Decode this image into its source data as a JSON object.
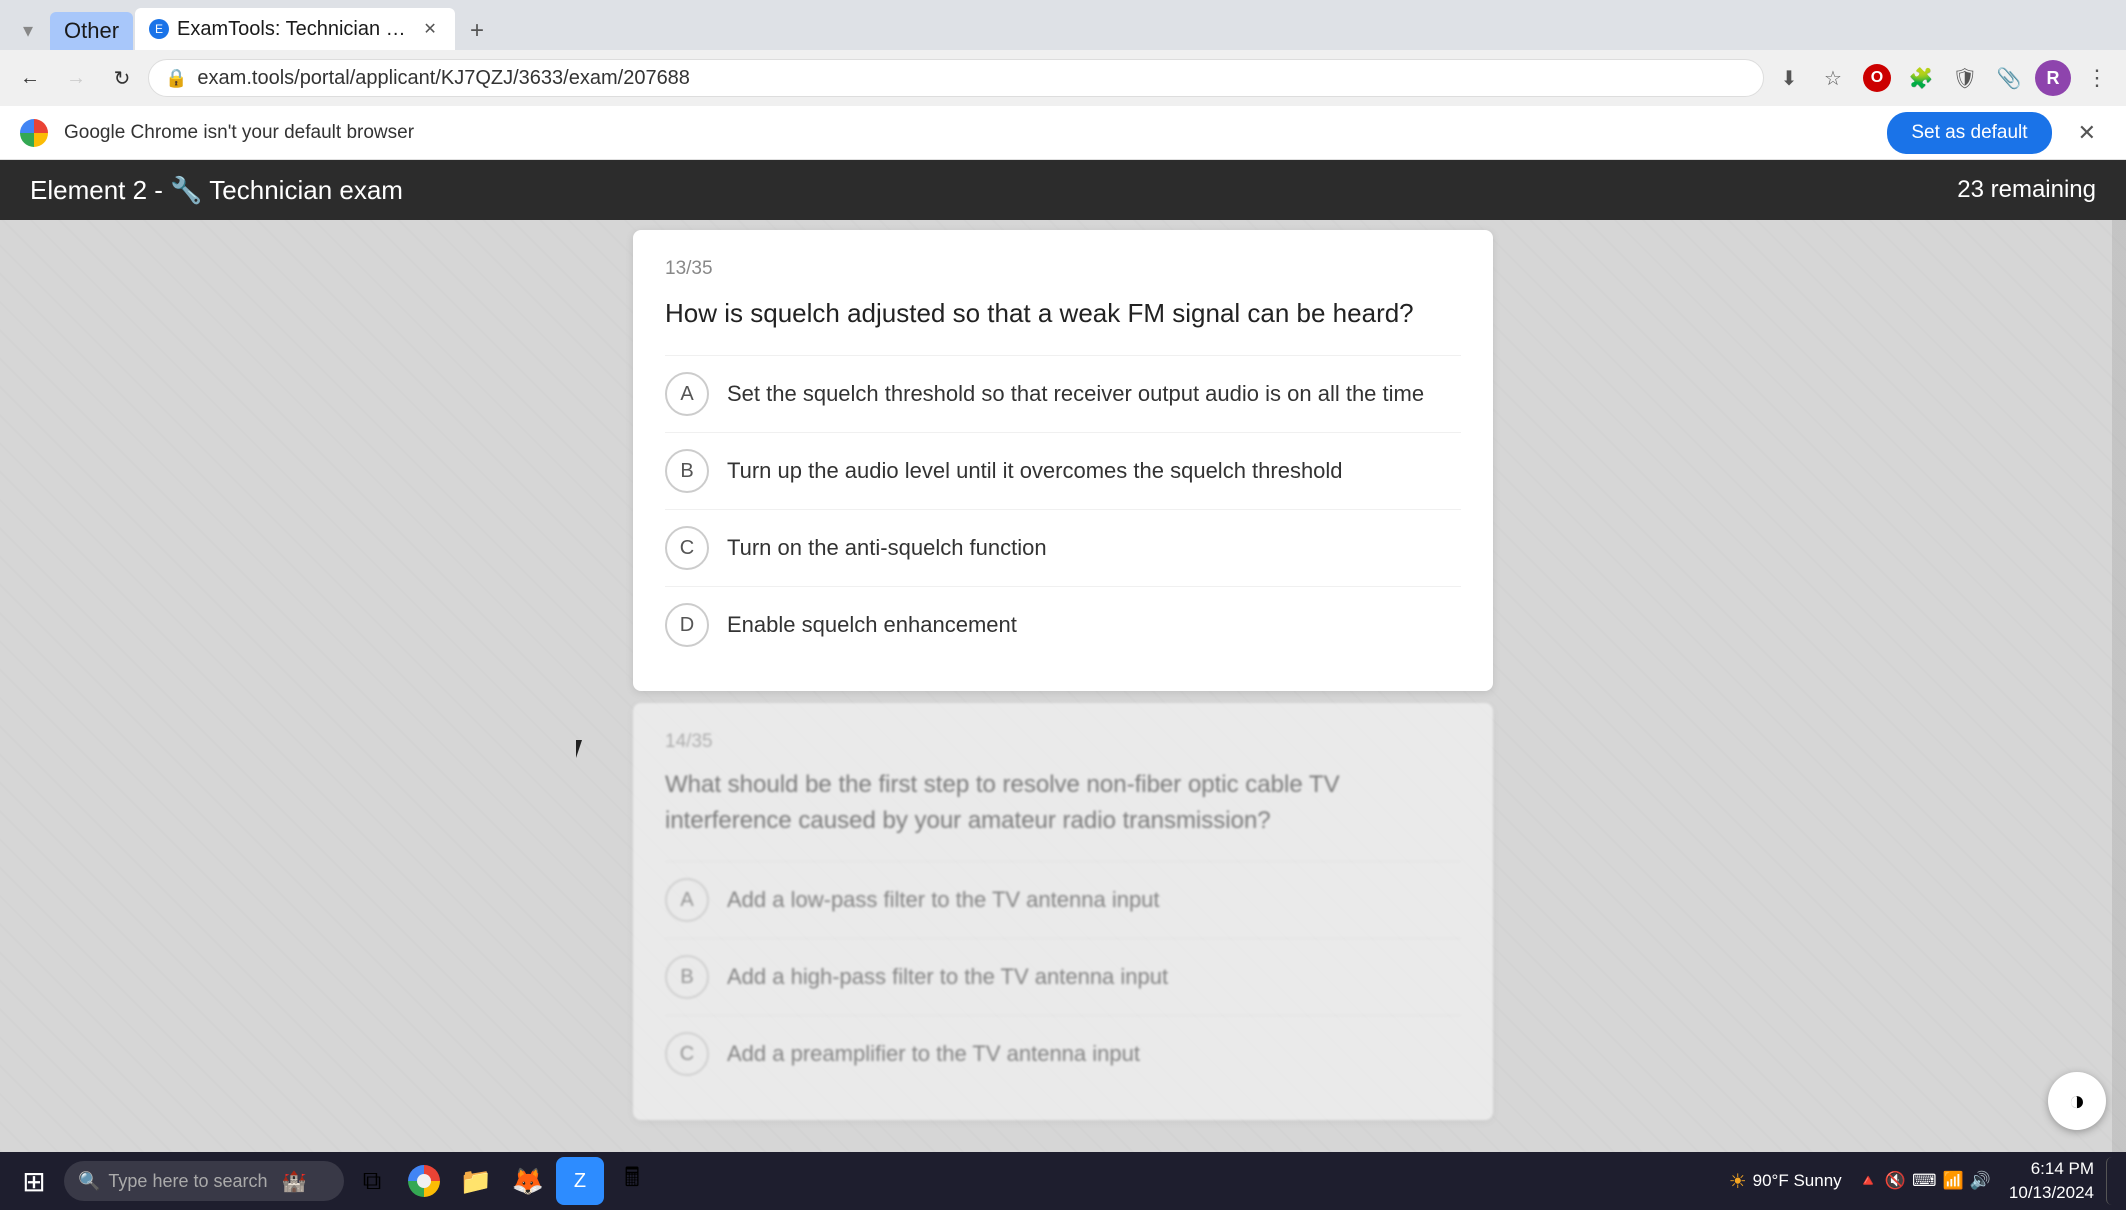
{
  "browser": {
    "tab_group_label": "Other",
    "tab_title": "ExamTools: Technician License :",
    "address": "exam.tools/portal/applicant/KJ7QZJ/3633/exam/207688",
    "notification_text": "Google Chrome isn't your default browser",
    "set_default_label": "Set as default"
  },
  "exam": {
    "title": "Element 2 - 🔧  Technician exam",
    "remaining": "23 remaining"
  },
  "question13": {
    "number": "13/35",
    "text": "How is squelch adjusted so that a weak FM signal can be heard?",
    "options": [
      {
        "letter": "A",
        "text": "Set the squelch threshold so that receiver output audio is on all the time"
      },
      {
        "letter": "B",
        "text": "Turn up the audio level until it overcomes the squelch threshold"
      },
      {
        "letter": "C",
        "text": "Turn on the anti-squelch function"
      },
      {
        "letter": "D",
        "text": "Enable squelch enhancement"
      }
    ]
  },
  "question14": {
    "number": "14/35",
    "text": "What should be the first step to resolve non-fiber optic cable TV interference caused by your amateur radio transmission?",
    "options": [
      {
        "letter": "A",
        "text": "Add a low-pass filter to the TV antenna input"
      },
      {
        "letter": "B",
        "text": "Add a high-pass filter to the TV antenna input"
      },
      {
        "letter": "C",
        "text": "Add a preamplifier to the TV antenna input"
      }
    ]
  },
  "taskbar": {
    "search_placeholder": "Type here to search",
    "weather": "90°F  Sunny",
    "time": "6:14 PM",
    "date": "10/13/2024"
  }
}
